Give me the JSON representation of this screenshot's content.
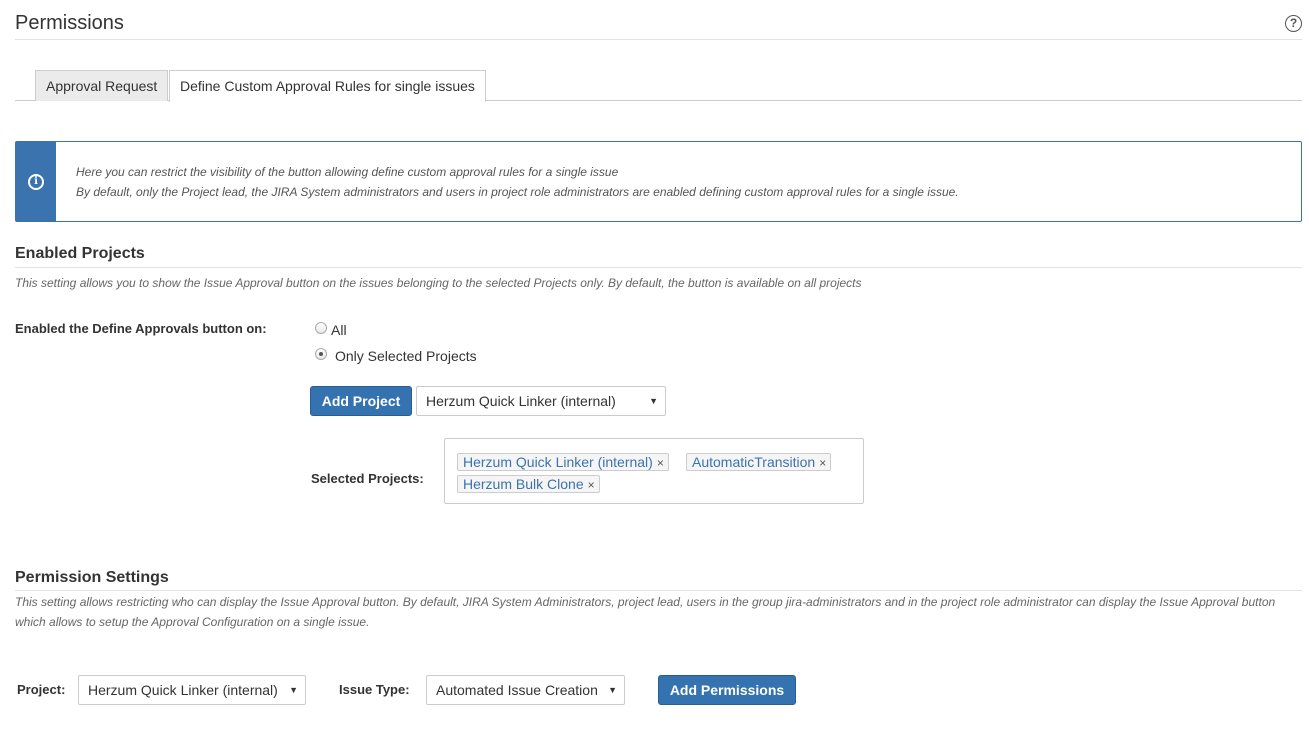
{
  "header": {
    "title": "Permissions",
    "help_icon": "?"
  },
  "tabs": [
    {
      "label": "Approval Request",
      "active": false
    },
    {
      "label": "Define Custom Approval Rules for single issues",
      "active": true
    }
  ],
  "info": {
    "icon": "info-icon",
    "line1": "Here you can restrict the visibility of the button allowing define custom approval rules for a single issue",
    "line2": "By default, only the Project lead, the JIRA System administrators and users in project role administrators are enabled defining custom approval rules for a single issue.",
    "accent": "#3b73af"
  },
  "enabled_projects": {
    "title": "Enabled Projects",
    "description": "This setting allows you to show the Issue Approval button on the issues belonging to the selected Projects only. By default, the button is available on all projects",
    "field_label": "Enabled the Define Approvals button on:",
    "options": [
      {
        "label": "All",
        "checked": false
      },
      {
        "label": "Only Selected Projects",
        "checked": true
      }
    ],
    "add_button": "Add Project",
    "project_select": "Herzum Quick Linker (internal)",
    "selected_label": "Selected Projects:",
    "selected": [
      "Herzum Quick Linker (internal)",
      "AutomaticTransition",
      "Herzum Bulk Clone"
    ],
    "remove_glyph": "×"
  },
  "permission_settings": {
    "title": "Permission Settings",
    "description_line1": "This setting allows restricting who can display the Issue Approval button. By default, JIRA System Administrators, project lead, users in the group jira-administrators and in the project role administrator can display the Issue Approval button",
    "description_line2": "which allows to setup the Approval Configuration on a single issue.",
    "project_label": "Project:",
    "project_value": "Herzum Quick Linker (internal)",
    "issue_type_label": "Issue Type:",
    "issue_type_value": "Automated Issue Creation",
    "add_button": "Add Permissions"
  },
  "colors": {
    "primary": "#3572b0",
    "link": "#3b73af"
  }
}
